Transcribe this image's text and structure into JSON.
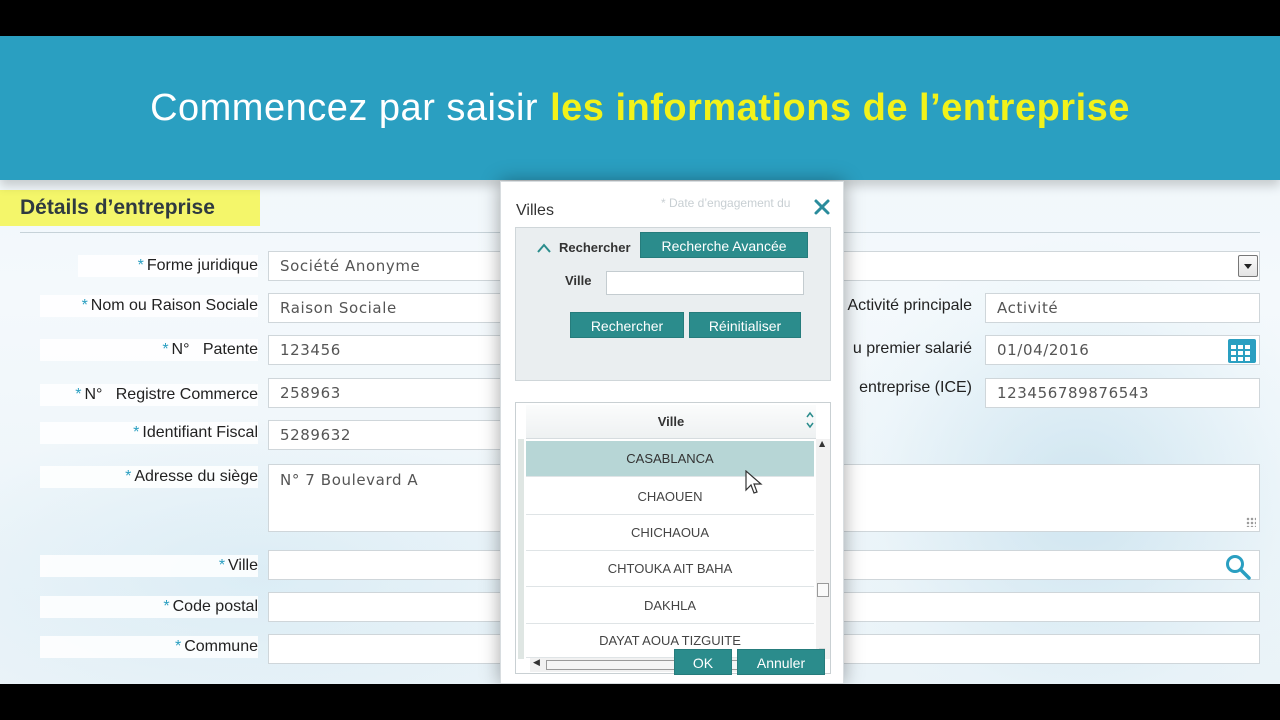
{
  "banner": {
    "text_plain": "Commencez par saisir",
    "text_highlight": "les informations de l’entreprise"
  },
  "section": {
    "title": "Détails d’entreprise"
  },
  "form": {
    "required_mark": "*",
    "forme_juridique": {
      "label": "Forme juridique",
      "value": "Société Anonyme"
    },
    "raison_sociale": {
      "label": "Nom ou Raison Sociale",
      "value": "Raison Sociale"
    },
    "patente": {
      "label": "N°   Patente",
      "value": "123456"
    },
    "registre_commerce": {
      "label": "N°   Registre Commerce",
      "value": "258963"
    },
    "identifiant_fiscal": {
      "label": "Identifiant Fiscal",
      "value": "5289632"
    },
    "adresse": {
      "label": "Adresse du siège",
      "value": "N° 7 Boulevard A"
    },
    "ville": {
      "label": "Ville",
      "value": ""
    },
    "code_postal": {
      "label": "Code postal",
      "value": ""
    },
    "commune": {
      "label": "Commune",
      "value": ""
    },
    "activite": {
      "label": "Activité principale",
      "value": "Activité"
    },
    "premier_salarie": {
      "label": "u premier salarié",
      "value": "01/04/2016"
    },
    "ice": {
      "label": "entreprise (ICE)",
      "value": "123456789876543"
    }
  },
  "dialog": {
    "title": "Villes",
    "ghost_text": "* Date d’engagement du",
    "search_toggle": "Rechercher",
    "advanced_button": "Recherche Avancée",
    "ville_label": "Ville",
    "ville_value": "",
    "search_button": "Rechercher",
    "reset_button": "Réinitialiser",
    "grid_header": "Ville",
    "rows": [
      "CASABLANCA",
      "CHAOUEN",
      "CHICHAOUA",
      "CHTOUKA AIT BAHA",
      "DAKHLA",
      "DAYAT AOUA TIZGUITE"
    ],
    "selected_index": 0,
    "ok_button": "OK",
    "cancel_button": "Annuler"
  },
  "icons": {
    "select": "chevron-down-icon",
    "date": "calendar-icon",
    "ville_search": "search-icon",
    "close": "close-icon",
    "collapse": "chevron-up-icon",
    "sort": "sort-icon",
    "cursor": "mouse-pointer-icon"
  },
  "colors": {
    "banner": "#2a9fc1",
    "highlight": "#f2f21a",
    "section_bg": "#f4f66a",
    "button": "#2b8c8c",
    "selected_row": "#b7d6d6",
    "required": "#2a9fc1"
  }
}
